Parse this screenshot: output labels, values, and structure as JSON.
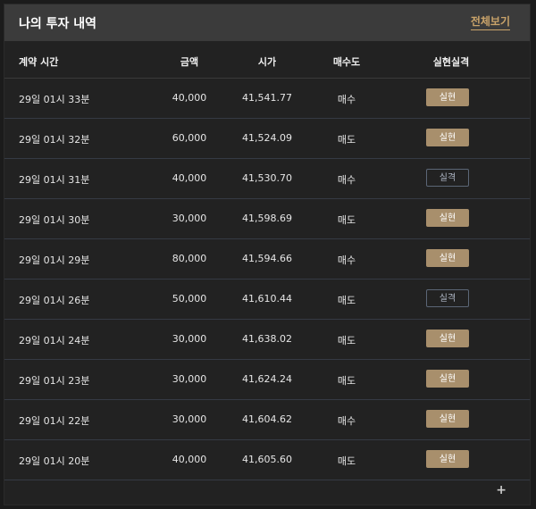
{
  "header": {
    "title": "나의 투자 내역",
    "view_all": "전체보기"
  },
  "columns": {
    "time": "계약 시간",
    "amount": "금액",
    "price": "시가",
    "side": "매수도",
    "result": "실현실격"
  },
  "rows": [
    {
      "time": "29일 01시 33분",
      "amount": "40,000",
      "price": "41,541.77",
      "side": "매수",
      "result": "실현",
      "status": "real"
    },
    {
      "time": "29일 01시 32분",
      "amount": "60,000",
      "price": "41,524.09",
      "side": "매도",
      "result": "실현",
      "status": "real"
    },
    {
      "time": "29일 01시 31분",
      "amount": "40,000",
      "price": "41,530.70",
      "side": "매수",
      "result": "실격",
      "status": "fail"
    },
    {
      "time": "29일 01시 30분",
      "amount": "30,000",
      "price": "41,598.69",
      "side": "매도",
      "result": "실현",
      "status": "real"
    },
    {
      "time": "29일 01시 29분",
      "amount": "80,000",
      "price": "41,594.66",
      "side": "매수",
      "result": "실현",
      "status": "real"
    },
    {
      "time": "29일 01시 26분",
      "amount": "50,000",
      "price": "41,610.44",
      "side": "매도",
      "result": "실격",
      "status": "fail"
    },
    {
      "time": "29일 01시 24분",
      "amount": "30,000",
      "price": "41,638.02",
      "side": "매도",
      "result": "실현",
      "status": "real"
    },
    {
      "time": "29일 01시 23분",
      "amount": "30,000",
      "price": "41,624.24",
      "side": "매도",
      "result": "실현",
      "status": "real"
    },
    {
      "time": "29일 01시 22분",
      "amount": "30,000",
      "price": "41,604.62",
      "side": "매수",
      "result": "실현",
      "status": "real"
    },
    {
      "time": "29일 01시 20분",
      "amount": "40,000",
      "price": "41,605.60",
      "side": "매도",
      "result": "실현",
      "status": "real"
    }
  ],
  "more": "+",
  "colors": {
    "accent": "#c9a36a",
    "real_button": "#a88f6c",
    "fail_border": "#5b6676",
    "header_bg": "#3b3b3b",
    "panel_bg": "#222222"
  }
}
